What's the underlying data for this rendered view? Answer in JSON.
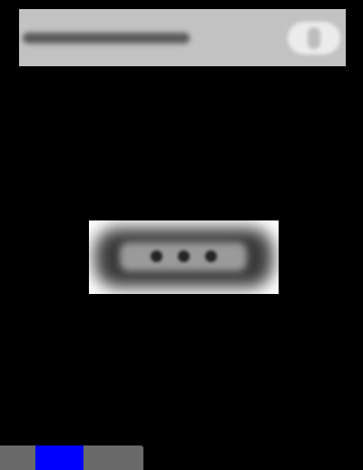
{
  "colors": {
    "background": "#000000",
    "banner": "#c2c2c2",
    "card": "#ffffff",
    "bottom_bar": "#6a6a6a",
    "active_segment": "#0000ff"
  },
  "banner": {
    "text_obscured": true,
    "close_icon": "close-icon"
  },
  "center_card": {
    "content_obscured": true,
    "dot_count": 3
  },
  "bottom_bar": {
    "active_segment_color": "#0000ff"
  }
}
